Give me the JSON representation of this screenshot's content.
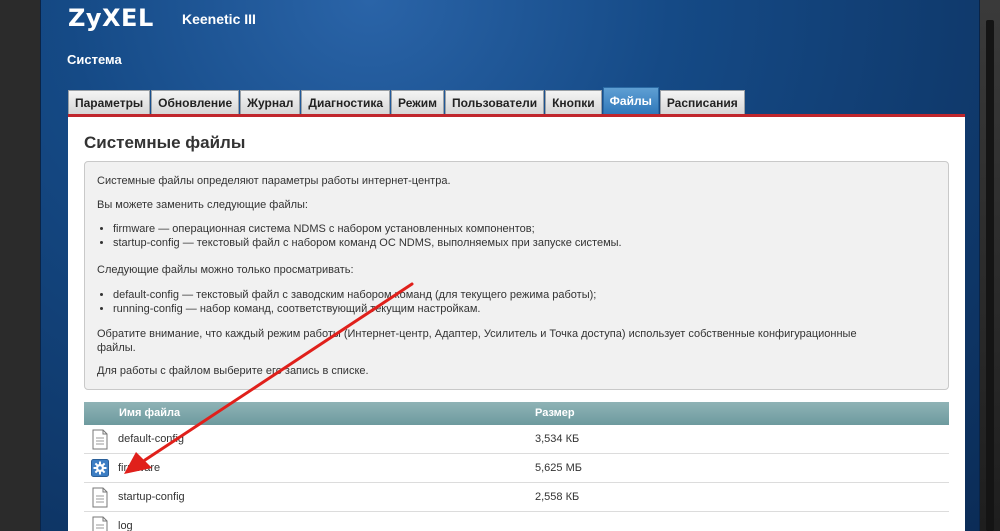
{
  "header": {
    "logo": "ZyXEL",
    "model": "Keenetic III",
    "section": "Система"
  },
  "tabs": [
    {
      "label": "Параметры",
      "active": false
    },
    {
      "label": "Обновление",
      "active": false
    },
    {
      "label": "Журнал",
      "active": false
    },
    {
      "label": "Диагностика",
      "active": false
    },
    {
      "label": "Режим",
      "active": false
    },
    {
      "label": "Пользователи",
      "active": false
    },
    {
      "label": "Кнопки",
      "active": false
    },
    {
      "label": "Файлы",
      "active": true
    },
    {
      "label": "Расписания",
      "active": false
    }
  ],
  "main": {
    "title": "Системные файлы",
    "info": {
      "p1": "Системные файлы определяют параметры работы интернет-центра.",
      "p2": "Вы можете заменить следующие файлы:",
      "replaceable": [
        "firmware — операционная система NDMS с набором установленных компонентов;",
        "startup-config — текстовый файл с набором команд ОС NDMS, выполняемых при запуске системы."
      ],
      "p3": "Следующие файлы можно только просматривать:",
      "viewonly": [
        "default-config — текстовый файл с заводским набором команд (для текущего режима работы);",
        "running-config — набор команд, соответствующий текущим настройкам."
      ],
      "p4a": "Обратите внимание, что каждый режим работы (Интернет-центр, Адаптер, Усилитель и Точка доступа) использует собственные конфигурационные",
      "p4b": "файлы.",
      "p5": "Для работы с файлом выберите его запись в списке."
    },
    "table": {
      "headers": {
        "name": "Имя файла",
        "size": "Размер"
      },
      "rows": [
        {
          "name": "default-config",
          "size": "3,534 КБ",
          "icon": "document-icon"
        },
        {
          "name": "firmware",
          "size": "5,625 МБ",
          "icon": "gear-icon"
        },
        {
          "name": "startup-config",
          "size": "2,558 КБ",
          "icon": "document-icon"
        },
        {
          "name": "log",
          "size": "",
          "icon": "document-icon"
        }
      ]
    }
  },
  "colors": {
    "accent_tab": "#2f78ba",
    "red_line": "#c0262c",
    "annotation_arrow": "#e0201b"
  }
}
